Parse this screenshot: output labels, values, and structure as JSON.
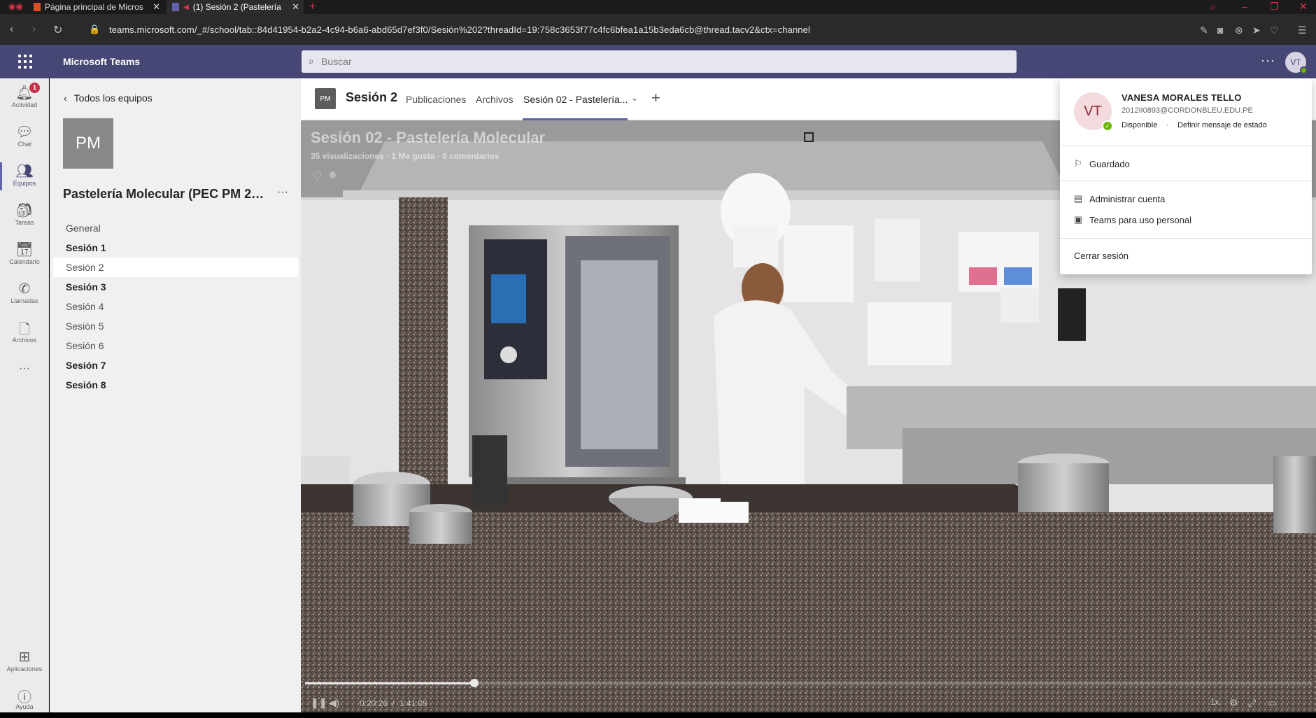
{
  "browser": {
    "tabs": [
      {
        "title": "Página principal de Micros"
      },
      {
        "title": "(1) Sesión 2 (Pastelería"
      }
    ],
    "url": "teams.microsoft.com/_#/school/tab::84d41954-b2a2-4c94-b6a6-abd65d7ef3f0/Sesión%202?threadId=19:758c3653f77c4fc6bfea1a15b3eda6cb@thread.tacv2&ctx=channel"
  },
  "header": {
    "app_title": "Microsoft Teams",
    "search_placeholder": "Buscar",
    "more": "···",
    "avatar_initials": "VT"
  },
  "rail": {
    "items": [
      {
        "label": "Actividad",
        "icon": "bell-icon",
        "badge": "1"
      },
      {
        "label": "Chat",
        "icon": "chat-icon"
      },
      {
        "label": "Equipos",
        "icon": "teams-icon"
      },
      {
        "label": "Tareas",
        "icon": "assignments-icon"
      },
      {
        "label": "Calendario",
        "icon": "calendar-icon"
      },
      {
        "label": "Llamadas",
        "icon": "phone-icon"
      },
      {
        "label": "Archivos",
        "icon": "file-icon"
      },
      {
        "label": "Aplicaciones",
        "icon": "apps-icon"
      },
      {
        "label": "Ayuda",
        "icon": "help-icon"
      }
    ],
    "more": "···"
  },
  "team_panel": {
    "back_label": "Todos los equipos",
    "team_initials": "PM",
    "team_name": "Pastelería Molecular (PEC PM 2022-1)",
    "more": "···",
    "channels": [
      {
        "name": "General",
        "bold": false
      },
      {
        "name": "Sesión 1",
        "bold": true
      },
      {
        "name": "Sesión 2",
        "bold": false,
        "selected": true
      },
      {
        "name": "Sesión 3",
        "bold": true
      },
      {
        "name": "Sesión 4",
        "bold": false
      },
      {
        "name": "Sesión 5",
        "bold": false
      },
      {
        "name": "Sesión 6",
        "bold": false
      },
      {
        "name": "Sesión 7",
        "bold": true
      },
      {
        "name": "Sesión 8",
        "bold": true
      }
    ]
  },
  "channel_header": {
    "avatar_initials": "PM",
    "title": "Sesión 2",
    "tabs": [
      "Publicaciones",
      "Archivos",
      "Sesión 02 - Pastelería..."
    ],
    "add": "+"
  },
  "video": {
    "title": "Sesión 02 - Pastelería Molecular",
    "meta": "35 visualizaciones · 1 Me gusta · 0 comentarios",
    "current_time": "0:20:26",
    "duration": "1:41:05",
    "progress": 0.168,
    "speed": "1x"
  },
  "profile_menu": {
    "initials": "VT",
    "name": "VANESA MORALES TELLO",
    "email": "2012II0893@CORDONBLEU.EDU.PE",
    "status": "Disponible",
    "separator": "·",
    "set_status": "Definir mensaje de estado",
    "items": [
      {
        "label": "Guardado",
        "icon": "bookmark-icon"
      },
      {
        "label": "Administrar cuenta",
        "icon": "account-card-icon"
      },
      {
        "label": "Teams para uso personal",
        "icon": "teams-personal-icon"
      },
      {
        "label": "Cerrar sesión"
      }
    ]
  },
  "colors": {
    "header": "#464775",
    "accent": "#6264a7",
    "available": "#6bb700",
    "badge": "#c4314b"
  }
}
